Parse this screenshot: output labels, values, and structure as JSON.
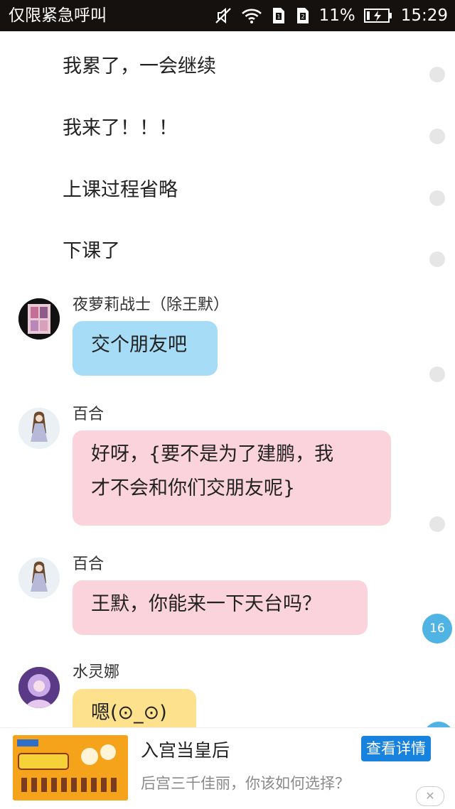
{
  "status_bar": {
    "carrier": "仅限紧急呼叫",
    "battery": "11%",
    "time": "15:29"
  },
  "chat": {
    "narration": [
      "我累了，一会继续",
      "我来了！！！",
      "上课过程省略",
      "下课了"
    ],
    "messages": [
      {
        "name": "夜萝莉战士（除王默）",
        "text": "交个朋友吧",
        "color": "#a6dcf6"
      },
      {
        "name": "百合",
        "line1": "好呀，{要不是为了建鹏，我",
        "line2": "才不会和你们交朋友呢}",
        "color": "#fbd3dc"
      },
      {
        "name": "百合",
        "text": "王默，你能来一下天台吗？",
        "color": "#fbd3dc"
      },
      {
        "name": "水灵娜",
        "text": "嗯(⊙_⊙)",
        "color": "#fde18c"
      }
    ],
    "unread_count": "16"
  },
  "ad": {
    "title": "入宫当皇后",
    "subtitle": "后宫三千佳丽，你该如何选择？",
    "button": "查看详情",
    "close": "✕"
  },
  "colors": {
    "status_bg": "#15110e",
    "accent": "#4fb3e4",
    "ad_button": "#1883df"
  }
}
